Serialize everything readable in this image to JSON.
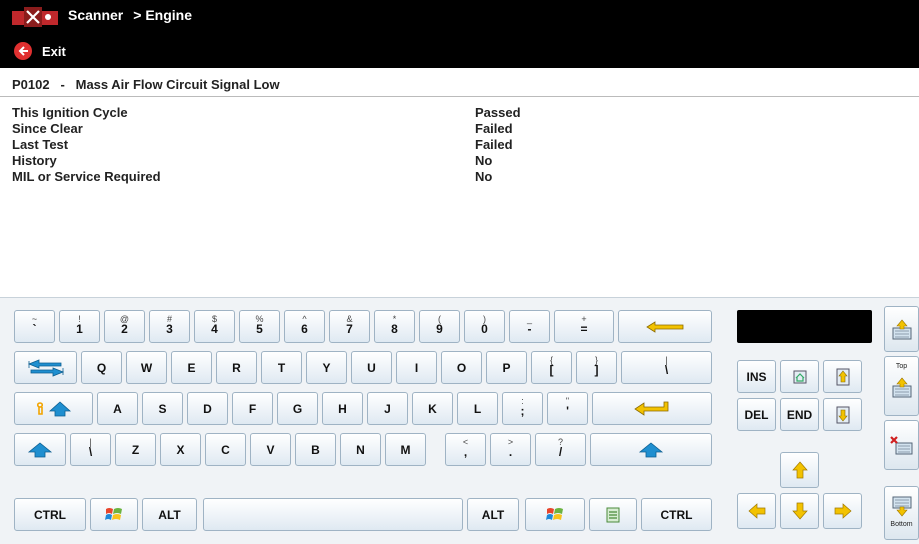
{
  "header": {
    "crumb_app": "Scanner",
    "crumb_sub": "> Engine",
    "exit_label": "Exit"
  },
  "dtc": {
    "code": "P0102",
    "dash": "-",
    "description": "Mass Air Flow Circuit Signal Low"
  },
  "status_rows": [
    {
      "label": "This Ignition Cycle",
      "value": "Passed"
    },
    {
      "label": "Since Clear",
      "value": "Failed"
    },
    {
      "label": "Last Test",
      "value": "Failed"
    },
    {
      "label": "History",
      "value": "No"
    },
    {
      "label": "MIL or Service Required",
      "value": "No"
    }
  ],
  "keyboard": {
    "row1": [
      {
        "shift": "~",
        "main": "`"
      },
      {
        "shift": "!",
        "main": "1"
      },
      {
        "shift": "@",
        "main": "2"
      },
      {
        "shift": "#",
        "main": "3"
      },
      {
        "shift": "$",
        "main": "4"
      },
      {
        "shift": "%",
        "main": "5"
      },
      {
        "shift": "^",
        "main": "6"
      },
      {
        "shift": "&",
        "main": "7"
      },
      {
        "shift": "*",
        "main": "8"
      },
      {
        "shift": "(",
        "main": "9"
      },
      {
        "shift": ")",
        "main": "0"
      },
      {
        "shift": "_",
        "main": "-"
      },
      {
        "shift": "+",
        "main": "="
      }
    ],
    "row2": [
      {
        "main": "Q"
      },
      {
        "main": "W"
      },
      {
        "main": "E"
      },
      {
        "main": "R"
      },
      {
        "main": "T"
      },
      {
        "main": "Y"
      },
      {
        "main": "U"
      },
      {
        "main": "I"
      },
      {
        "main": "O"
      },
      {
        "main": "P"
      },
      {
        "shift": "{",
        "main": "["
      },
      {
        "shift": "}",
        "main": "]"
      },
      {
        "shift": "|",
        "main": "\\"
      }
    ],
    "row3": [
      {
        "main": "A"
      },
      {
        "main": "S"
      },
      {
        "main": "D"
      },
      {
        "main": "F"
      },
      {
        "main": "G"
      },
      {
        "main": "H"
      },
      {
        "main": "J"
      },
      {
        "main": "K"
      },
      {
        "main": "L"
      },
      {
        "shift": ":",
        "main": ";"
      },
      {
        "shift": "\"",
        "main": "'"
      }
    ],
    "row4": [
      {
        "shift": "|",
        "main": "\\"
      },
      {
        "main": "Z"
      },
      {
        "main": "X"
      },
      {
        "main": "C"
      },
      {
        "main": "V"
      },
      {
        "main": "B"
      },
      {
        "main": "N"
      },
      {
        "main": "M"
      },
      {
        "shift": "<",
        "main": ","
      },
      {
        "shift": ">",
        "main": "."
      },
      {
        "shift": "?",
        "main": "/"
      }
    ],
    "ctrl_left": "CTRL",
    "alt_left": "ALT",
    "alt_right": "ALT",
    "ctrl_right": "CTRL"
  },
  "nav_keys": {
    "ins": "INS",
    "del": "DEL",
    "end": "END"
  },
  "side": {
    "top_label": "Top",
    "bottom_label": "Bottom"
  },
  "colors": {
    "header_bg": "#000000",
    "arrow_yellow": "#f2c200",
    "key_border": "#9fb3c4"
  },
  "icons": {
    "app_logo": "scanner-logo-icon",
    "exit": "back-arrow-icon",
    "backspace": "backspace-arrow-icon",
    "tab": "tab-arrows-icon",
    "caps": "caps-lock-icon",
    "enter": "enter-arrow-icon",
    "shift": "shift-arrow-icon",
    "windows": "windows-logo-icon",
    "menu": "context-menu-icon"
  }
}
